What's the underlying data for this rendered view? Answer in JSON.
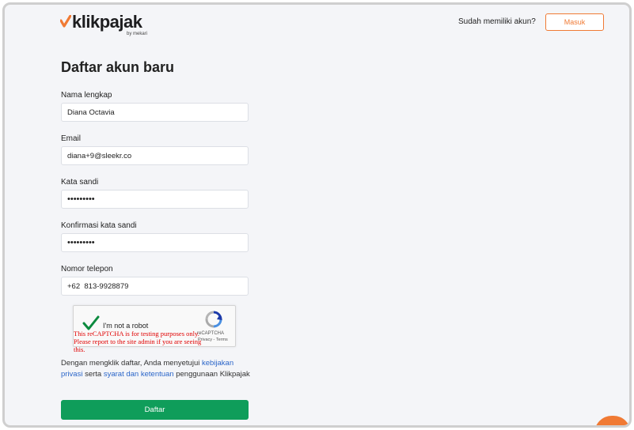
{
  "brand": {
    "name": "klikpajak",
    "sub": "by mekari",
    "accent_color": "#f07a34"
  },
  "header": {
    "have_account_text": "Sudah memiliki akun?",
    "login_label": "Masuk"
  },
  "form": {
    "title": "Daftar akun baru",
    "fields": [
      {
        "label": "Nama lengkap",
        "value": "Diana Octavia"
      },
      {
        "label": "Email",
        "value": "diana+9@sleekr.co"
      },
      {
        "label": "Kata sandi",
        "value": "•••••••••"
      },
      {
        "label": "Konfirmasi kata sandi",
        "value": "•••••••••"
      },
      {
        "label": "Nomor telepon",
        "value": "+62  813-9928879"
      }
    ]
  },
  "captcha": {
    "label": "I'm not a robot",
    "brand": "reCAPTCHA",
    "links": "Privacy - Terms",
    "warning": "This reCAPTCHA is for testing purposes only. Please report to the site admin if you are seeing this."
  },
  "terms": {
    "prefix": "Dengan mengklik daftar, Anda menyetujui ",
    "privacy_link": "kebijakan privasi",
    "middle": " serta ",
    "terms_link": "syarat dan ketentuan",
    "suffix": " penggunaan Klikpajak"
  },
  "submit": {
    "label": "Daftar",
    "color": "#0f9d5a"
  }
}
